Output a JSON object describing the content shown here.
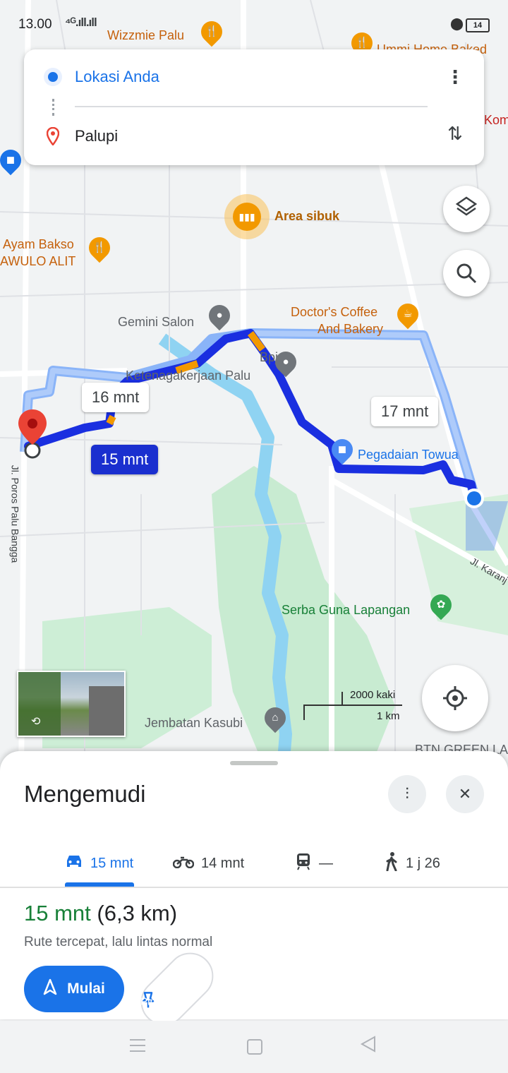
{
  "status_bar": {
    "time": "13.00",
    "signal": "⁴ᴳ.ıll.ıll",
    "battery": "14"
  },
  "route_card": {
    "from": "Lokasi Anda",
    "to": "Palupi"
  },
  "map": {
    "pois": {
      "wizzmie": "Wizzmie Palu",
      "ummi": "Ummi Home Baked",
      "area_sibuk": "Area sibuk",
      "ayam_bakso": "Ayam Bakso",
      "awulo": "AWULO ALIT",
      "gemini": "Gemini Salon",
      "doctors_coffee_1": "Doctor's Coffee",
      "doctors_coffee_2": "And Bakery",
      "bpjs_1": "Bpjs",
      "bpjs_2": "Ketenagakerjaan Palu",
      "pegadaian": "Pegadaian Towua",
      "serba_guna": "Serba Guna Lapangan",
      "jembatan": "Jembatan Kasubi",
      "btn": "BTN GREEN LA",
      "komp": "Komp"
    },
    "streets": {
      "poros": "Jl. Poros Palu Bangga",
      "karanja": "Jl. Karanj"
    },
    "time_labels": {
      "alt1": "16 mnt",
      "main": "15 mnt",
      "alt2": "17 mnt"
    },
    "scale": {
      "top": "2000 kaki",
      "bottom": "1 km"
    },
    "colors": {
      "route": "#1a2fe0",
      "alt_route": "#8ab4f8",
      "traffic": "#f29900",
      "pin": "#ea4335"
    }
  },
  "sheet": {
    "title": "Mengemudi",
    "modes": [
      {
        "icon": "car-icon",
        "label": "15 mnt"
      },
      {
        "icon": "motorcycle-icon",
        "label": "14 mnt"
      },
      {
        "icon": "transit-icon",
        "label": "—"
      },
      {
        "icon": "walk-icon",
        "label": "1 j 26"
      }
    ],
    "duration": "15 mnt",
    "distance": "(6,3 km)",
    "description": "Rute tercepat, lalu lintas normal",
    "start_label": "Mulai",
    "pin_label": "Pin"
  }
}
